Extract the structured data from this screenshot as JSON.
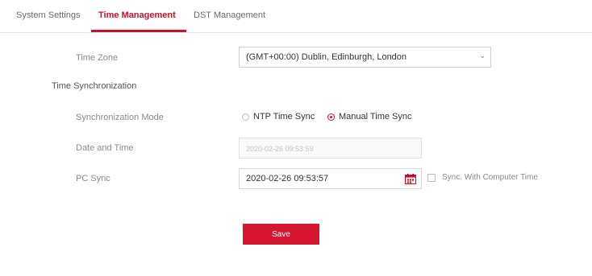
{
  "tabs": [
    {
      "label": "System Settings",
      "active": false
    },
    {
      "label": "Time Management",
      "active": true
    },
    {
      "label": "DST Management",
      "active": false
    }
  ],
  "form": {
    "time_zone_label": "Time Zone",
    "time_zone_value": "(GMT+00:00) Dublin, Edinburgh, London",
    "sync_section_title": "Time Synchronization",
    "sync_mode_label": "Synchronization Mode",
    "sync_options": [
      {
        "label": "NTP Time Sync",
        "checked": false
      },
      {
        "label": "Manual Time Sync",
        "checked": true
      }
    ],
    "date_time_label": "Date and Time",
    "date_time_value": "2020-02-26 09:53:59",
    "pc_sync_label": "PC Sync",
    "pc_sync_value": "2020-02-26 09:53:57",
    "sync_computer_label": "Sync. With Computer Time",
    "save_label": "Save"
  },
  "colors": {
    "accent": "#c8102e",
    "save_button": "#d7162f"
  },
  "icons": {
    "select_arrow": "chevron-down-icon",
    "calendar": "calendar-icon"
  }
}
